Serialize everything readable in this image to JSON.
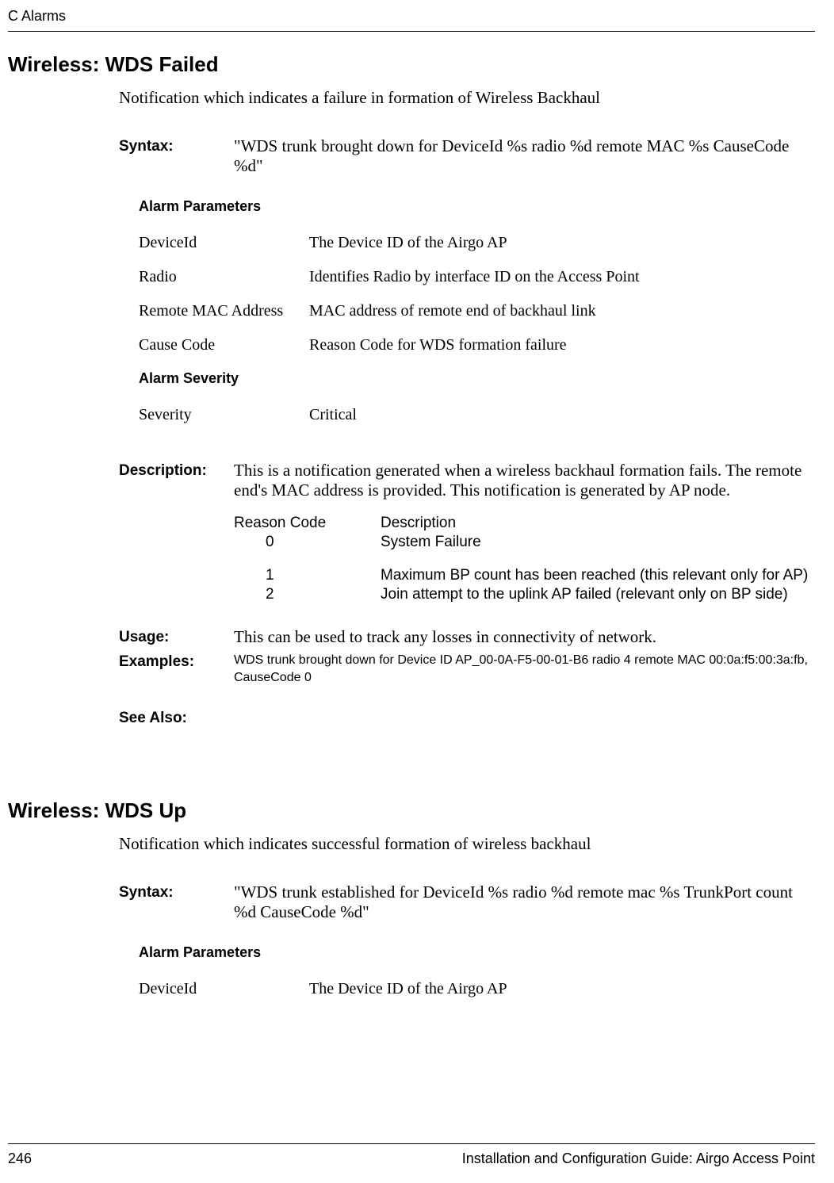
{
  "header": {
    "left": "C  Alarms"
  },
  "section1": {
    "title": "Wireless: WDS Failed",
    "intro": "Notification which indicates a failure in formation of Wireless Backhaul",
    "syntax_label": "Syntax:",
    "syntax_value": "\"WDS trunk brought down for DeviceId %s radio %d remote MAC %s CauseCode %d\"",
    "alarm_params_head": "Alarm Parameters",
    "params": [
      {
        "name": " DeviceId",
        "desc": "The Device ID of the Airgo AP"
      },
      {
        "name": "Radio",
        "desc": "Identifies Radio by interface ID on the Access Point"
      },
      {
        "name": "Remote MAC Address",
        "desc": "MAC address of  remote end of backhaul link"
      },
      {
        "name": "Cause Code",
        "desc": "Reason Code for WDS formation failure"
      }
    ],
    "severity_head": "Alarm Severity",
    "severity_name": "Severity",
    "severity_value": "Critical",
    "description_label": "Description:",
    "description_value": "This is a notification generated when a wireless backhaul formation fails. The remote end's MAC address is provided. This notification is generated by AP node.",
    "reason_head_code": "Reason Code",
    "reason_head_desc": "Description",
    "reasons": [
      {
        "code": "0",
        "desc": "System Failure"
      },
      {
        "code": "1",
        "desc": "Maximum BP count has been reached (this relevant only for AP)"
      },
      {
        "code": "2",
        "desc": "Join attempt to the uplink AP failed (relevant only on BP side)"
      }
    ],
    "usage_label": "Usage:",
    "usage_value": "This can be used to track any losses in connectivity of network.",
    "examples_label": "Examples:",
    "examples_value": "WDS trunk brought down for Device ID AP_00-0A-F5-00-01-B6 radio 4  remote MAC 00:0a:f5:00:3a:fb, CauseCode 0",
    "seealso_label": "See Also:"
  },
  "section2": {
    "title": "Wireless: WDS Up",
    "intro": "Notification which indicates successful formation of wireless backhaul",
    "syntax_label": "Syntax:",
    "syntax_value": "\"WDS trunk established for DeviceId %s radio %d remote mac %s TrunkPort count %d CauseCode %d\"",
    "alarm_params_head": "Alarm Parameters",
    "params": [
      {
        "name": "DeviceId",
        "desc": "The Device ID of the Airgo AP"
      }
    ]
  },
  "footer": {
    "page": "246",
    "right": "Installation and Configuration Guide: Airgo Access Point"
  }
}
